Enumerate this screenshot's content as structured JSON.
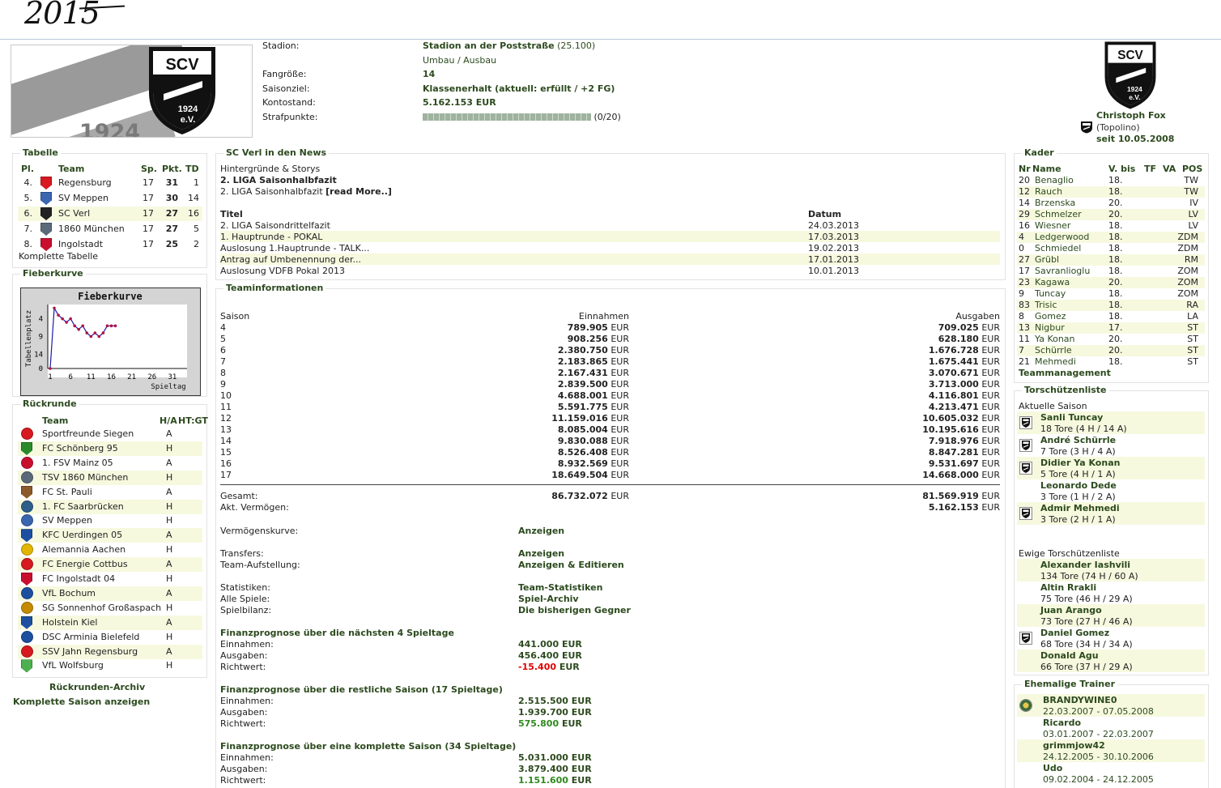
{
  "annotation": "2015",
  "header": {
    "banner_year": "1924",
    "crest": {
      "abbr": "SCV",
      "year": "1924",
      "ev": "e.V."
    },
    "stadion_label": "Stadion:",
    "stadion_name": "Stadion an der Poststraße",
    "stadion_capacity": "(25.100)",
    "umbau": "Umbau / Ausbau",
    "fans_label": "Fangröße:",
    "fans_value": "14",
    "saisonziel_label": "Saisonziel:",
    "saisonziel_value": "Klassenerhalt (aktuell: erfüllt / +2 FG)",
    "konto_label": "Kontostand:",
    "konto_value": "5.162.153 EUR",
    "strafpunkte_label": "Strafpunkte:",
    "strafpunkte_value": "(0/20)",
    "strafpunkte_fraction": 0,
    "manager_name": "Christoph Fox",
    "manager_nick": "(Topolino)",
    "manager_since": "seit 10.05.2008"
  },
  "tabelle": {
    "title": "Tabelle",
    "headers": [
      "Pl.",
      "Team",
      "Sp.",
      "Pkt.",
      "TD"
    ],
    "rows": [
      {
        "pl": "4.",
        "team": "Regensburg",
        "sp": "17",
        "pkt": "31",
        "td": "1",
        "logo_color": "#d71920",
        "highlight": false
      },
      {
        "pl": "5.",
        "team": "SV Meppen",
        "sp": "17",
        "pkt": "30",
        "td": "14",
        "logo_color": "#3a66b0",
        "highlight": false
      },
      {
        "pl": "6.",
        "team": "SC Verl",
        "sp": "17",
        "pkt": "27",
        "td": "16",
        "logo_color": "#222222",
        "highlight": true
      },
      {
        "pl": "7.",
        "team": "1860 München",
        "sp": "17",
        "pkt": "27",
        "td": "5",
        "logo_color": "#5a6a7a",
        "highlight": false
      },
      {
        "pl": "8.",
        "team": "Ingolstadt",
        "sp": "17",
        "pkt": "25",
        "td": "2",
        "logo_color": "#c8102e",
        "highlight": false
      }
    ],
    "footer_link": "Komplette Tabelle"
  },
  "fieberkurve": {
    "title": "Fieberkurve",
    "chart_title": "Fieberkurve",
    "ylabel": "Tabellenplatz",
    "xlabel": "Spieltag",
    "yticks": [
      "4",
      "9",
      "14",
      "0"
    ],
    "xticks": [
      "1",
      "6",
      "11",
      "16",
      "21",
      "26",
      "31"
    ]
  },
  "chart_data": {
    "type": "line",
    "title": "Fieberkurve",
    "xlabel": "Spieltag",
    "ylabel": "Tabellenplatz",
    "x": [
      1,
      2,
      3,
      4,
      5,
      6,
      7,
      8,
      9,
      10,
      11,
      12,
      13,
      14,
      15,
      16,
      17
    ],
    "values": [
      18,
      1,
      3,
      4,
      5,
      4,
      6,
      7,
      6,
      8,
      9,
      8,
      9,
      8,
      6,
      6,
      6
    ],
    "xlim": [
      1,
      34
    ],
    "ylim": [
      0,
      18
    ]
  },
  "rueckrunde": {
    "title": "Rückrunde",
    "headers": [
      "Team",
      "H/A",
      "HT:GT"
    ],
    "rows": [
      {
        "team": "Sportfreunde Siegen",
        "ha": "A",
        "logo_color": "#d71920"
      },
      {
        "team": "FC Schönberg 95",
        "ha": "H",
        "logo_color": "#2a8a2a"
      },
      {
        "team": "1. FSV Mainz 05",
        "ha": "A",
        "logo_color": "#c8102e"
      },
      {
        "team": "TSV 1860 München",
        "ha": "H",
        "logo_color": "#5a6a7a"
      },
      {
        "team": "FC St. Pauli",
        "ha": "A",
        "logo_color": "#8b5a2b"
      },
      {
        "team": "1. FC Saarbrücken",
        "ha": "H",
        "logo_color": "#2c5f8a"
      },
      {
        "team": "SV Meppen",
        "ha": "H",
        "logo_color": "#3a66b0"
      },
      {
        "team": "KFC Uerdingen 05",
        "ha": "A",
        "logo_color": "#1d4fa0"
      },
      {
        "team": "Alemannia Aachen",
        "ha": "H",
        "logo_color": "#e2b600"
      },
      {
        "team": "FC Energie Cottbus",
        "ha": "A",
        "logo_color": "#d71920"
      },
      {
        "team": "FC Ingolstadt 04",
        "ha": "H",
        "logo_color": "#c8102e"
      },
      {
        "team": "VfL Bochum",
        "ha": "A",
        "logo_color": "#1d4fa0"
      },
      {
        "team": "SG Sonnenhof Großaspach",
        "ha": "H",
        "logo_color": "#c48a00"
      },
      {
        "team": "Holstein Kiel",
        "ha": "A",
        "logo_color": "#1d4fa0"
      },
      {
        "team": "DSC Arminia Bielefeld",
        "ha": "H",
        "logo_color": "#1d4fa0"
      },
      {
        "team": "SSV Jahn Regensburg",
        "ha": "A",
        "logo_color": "#d71920"
      },
      {
        "team": "VfL Wolfsburg",
        "ha": "H",
        "logo_color": "#4caf50"
      }
    ],
    "archiv_link": "Rückrunden-Archiv",
    "saison_link": "Komplette Saison anzeigen"
  },
  "news": {
    "title": "SC Verl in den News",
    "section": "Hintergründe & Storys",
    "headline": "2. LIGA Saisonhalbfazit",
    "teaser": "2. LIGA Saisonhalbfazit",
    "read_more": "[read More..]",
    "col_title": "Titel",
    "col_date": "Datum",
    "items": [
      {
        "title": "2. LIGA Saisondrittelfazit",
        "date": "24.03.2013"
      },
      {
        "title": "1. Hauptrunde - POKAL",
        "date": "17.03.2013"
      },
      {
        "title": "Auslosung 1.Hauptrunde - TALK...",
        "date": "19.02.2013"
      },
      {
        "title": "Antrag auf Umbenennung der...",
        "date": "17.01.2013"
      },
      {
        "title": "Auslosung VDFB Pokal 2013",
        "date": "10.01.2013"
      }
    ]
  },
  "teaminfo": {
    "title": "Teaminformationen",
    "col_saison": "Saison",
    "col_einnahmen": "Einnahmen",
    "col_ausgaben": "Ausgaben",
    "currency": "EUR",
    "rows": [
      {
        "saison": "4",
        "ein": "789.905",
        "aus": "709.025"
      },
      {
        "saison": "5",
        "ein": "908.256",
        "aus": "628.180"
      },
      {
        "saison": "6",
        "ein": "2.380.750",
        "aus": "1.676.728"
      },
      {
        "saison": "7",
        "ein": "2.183.865",
        "aus": "1.675.441"
      },
      {
        "saison": "8",
        "ein": "2.167.431",
        "aus": "3.070.671"
      },
      {
        "saison": "9",
        "ein": "2.839.500",
        "aus": "3.713.000"
      },
      {
        "saison": "10",
        "ein": "4.688.001",
        "aus": "4.116.801"
      },
      {
        "saison": "11",
        "ein": "5.591.775",
        "aus": "4.213.471"
      },
      {
        "saison": "12",
        "ein": "11.159.016",
        "aus": "10.605.032"
      },
      {
        "saison": "13",
        "ein": "8.085.004",
        "aus": "10.195.616"
      },
      {
        "saison": "14",
        "ein": "9.830.088",
        "aus": "7.918.976"
      },
      {
        "saison": "15",
        "ein": "8.526.408",
        "aus": "8.847.281"
      },
      {
        "saison": "16",
        "ein": "8.932.569",
        "aus": "9.531.697"
      },
      {
        "saison": "17",
        "ein": "18.649.504",
        "aus": "14.668.000"
      }
    ],
    "gesamt_label": "Gesamt:",
    "gesamt_ein": "86.732.072",
    "gesamt_aus": "81.569.919",
    "vermoegen_label": "Akt. Vermögen:",
    "vermoegen_value": "5.162.153",
    "links": [
      {
        "label": "Vermögenskurve:",
        "value": "Anzeigen"
      },
      {
        "label": "Transfers:",
        "value": "Anzeigen"
      },
      {
        "label": "Team-Aufstellung:",
        "value": "Anzeigen & Editieren"
      },
      {
        "label": "Statistiken:",
        "value": "Team-Statistiken"
      },
      {
        "label": "Alle Spiele:",
        "value": "Spiel-Archiv"
      },
      {
        "label": "Spielbilanz:",
        "value": "Die bisherigen Gegner"
      }
    ],
    "prognosen": [
      {
        "title": "Finanzprognose über die nächsten 4 Spieltage",
        "ein": "441.000",
        "aus": "456.400",
        "richt_num": "-15.400",
        "richt_color": "#e00000"
      },
      {
        "title": "Finanzprognose über die restliche Saison (17 Spieltage)",
        "ein": "2.515.500",
        "aus": "1.939.700",
        "richt_num": "575.800",
        "richt_color": "#2f8a1e"
      },
      {
        "title": "Finanzprognose über eine komplette Saison (34 Spieltage)",
        "ein": "5.031.000",
        "aus": "3.879.400",
        "richt_num": "1.151.600",
        "richt_color": "#2f8a1e"
      }
    ],
    "prog_ein_label": "Einnahmen:",
    "prog_aus_label": "Ausgaben:",
    "prog_richt_label": "Richtwert:"
  },
  "kader": {
    "title": "Kader",
    "headers": [
      "Nr",
      "Name",
      "V. bis",
      "TF",
      "VA",
      "POS"
    ],
    "rows": [
      {
        "nr": "20",
        "name": "Benaglio",
        "vbis": "18.",
        "pos": "TW"
      },
      {
        "nr": "12",
        "name": "Rauch",
        "vbis": "18.",
        "pos": "TW"
      },
      {
        "nr": "14",
        "name": "Brzenska",
        "vbis": "20.",
        "pos": "IV"
      },
      {
        "nr": "29",
        "name": "Schmelzer",
        "vbis": "20.",
        "pos": "LV"
      },
      {
        "nr": "16",
        "name": "Wiesner",
        "vbis": "18.",
        "pos": "LV"
      },
      {
        "nr": "4",
        "name": "Ledgerwood",
        "vbis": "18.",
        "pos": "ZDM"
      },
      {
        "nr": "0",
        "name": "Schmiedel",
        "vbis": "18.",
        "pos": "ZDM"
      },
      {
        "nr": "27",
        "name": "Grübl",
        "vbis": "18.",
        "pos": "RM"
      },
      {
        "nr": "17",
        "name": "Savranlioglu",
        "vbis": "18.",
        "pos": "ZOM"
      },
      {
        "nr": "23",
        "name": "Kagawa",
        "vbis": "20.",
        "pos": "ZOM"
      },
      {
        "nr": "9",
        "name": "Tuncay",
        "vbis": "18.",
        "pos": "ZOM"
      },
      {
        "nr": "83",
        "name": "Trisic",
        "vbis": "18.",
        "pos": "RA"
      },
      {
        "nr": "8",
        "name": "Gomez",
        "vbis": "18.",
        "pos": "LA"
      },
      {
        "nr": "13",
        "name": "Nigbur",
        "vbis": "17.",
        "pos": "ST"
      },
      {
        "nr": "11",
        "name": "Ya Konan",
        "vbis": "20.",
        "pos": "ST"
      },
      {
        "nr": "7",
        "name": "Schürrle",
        "vbis": "20.",
        "pos": "ST"
      },
      {
        "nr": "21",
        "name": "Mehmedi",
        "vbis": "18.",
        "pos": "ST"
      }
    ],
    "footer_link": "Teammanagement"
  },
  "torschuetzen": {
    "title": "Torschützenliste",
    "aktuelle_label": "Aktuelle Saison",
    "aktuelle": [
      {
        "name": "Sanli Tuncay",
        "stats": "18 Tore (4 H / 14 A)",
        "icon": true
      },
      {
        "name": "André Schürrle",
        "stats": "7 Tore (3 H / 4 A)",
        "icon": true
      },
      {
        "name": "Didier Ya Konan",
        "stats": "5 Tore (4 H / 1 A)",
        "icon": true
      },
      {
        "name": "Leonardo Dede",
        "stats": "3 Tore (1 H / 2 A)",
        "icon": false
      },
      {
        "name": "Admir Mehmedi",
        "stats": "3 Tore (2 H / 1 A)",
        "icon": true
      }
    ],
    "ewige_label": "Ewige Torschützenliste",
    "ewige": [
      {
        "name": "Alexander Iashvili",
        "stats": "134 Tore (74 H / 60 A)",
        "icon": false
      },
      {
        "name": "Altin Rrakli",
        "stats": "75 Tore (46 H / 29 A)",
        "icon": false
      },
      {
        "name": "Juan Arango",
        "stats": "73 Tore (27 H / 46 A)",
        "icon": false
      },
      {
        "name": "Daniel Gomez",
        "stats": "68 Tore (34 H / 34 A)",
        "icon": true
      },
      {
        "name": "Donald Agu",
        "stats": "66 Tore (37 H / 29 A)",
        "icon": false
      }
    ]
  },
  "trainer": {
    "title": "Ehemalige Trainer",
    "items": [
      {
        "name": "BRANDYWINE0",
        "dates": "22.03.2007 - 07.05.2008",
        "icon": true
      },
      {
        "name": "Ricardo",
        "dates": "03.01.2007 - 22.03.2007",
        "icon": false
      },
      {
        "name": "grimmjow42",
        "dates": "24.12.2005 - 30.10.2006",
        "icon": false
      },
      {
        "name": "Udo",
        "dates": "09.02.2004 - 24.12.2005",
        "icon": false
      }
    ]
  },
  "colors": {
    "accent_green": "#2c4a1e",
    "highlight_row": "#f7f9df",
    "box_border": "#e2e2e2"
  }
}
